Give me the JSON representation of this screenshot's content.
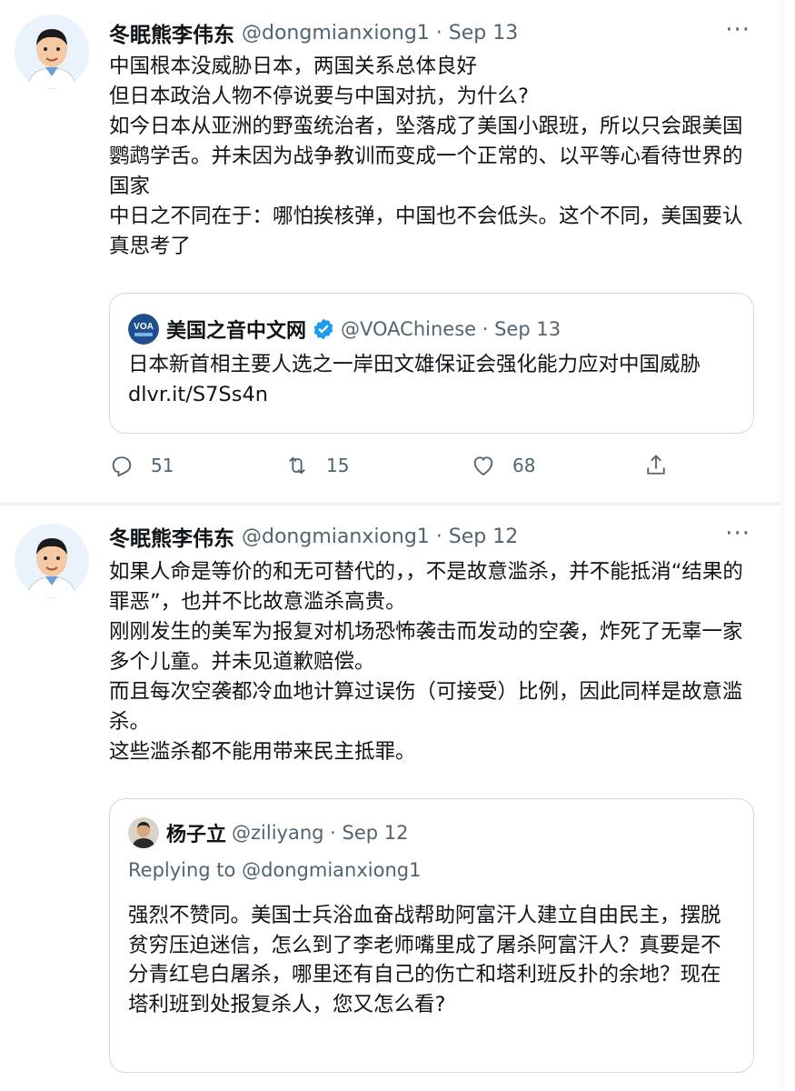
{
  "tweets": [
    {
      "author_name": "冬眠熊李伟东",
      "author_handle_date": "@dongmianxiong1 · Sep 13",
      "more_label": "···",
      "body": [
        "中国根本没威胁日本，两国关系总体良好",
        "但日本政治人物不停说要与中国对抗，为什么?",
        "如今日本从亚洲的野蛮统治者，坠落成了美国小跟班，所以只会跟美国鹦鹉学舌。并未因为战争教训而变成一个正常的、以平等心看待世界的国家",
        "中日之不同在于：哪怕挨核弹，中国也不会低头。这个不同，美国要认真思考了"
      ],
      "quote": {
        "name": "美国之音中文网",
        "handle_date": "@VOAChinese · Sep 13",
        "avatar_text": "VOA",
        "body": "日本新首相主要人选之一岸田文雄保证会强化能力应对中国威胁 dlvr.it/S7Ss4n"
      },
      "actions": {
        "reply_count": "51",
        "retweet_count": "15",
        "like_count": "68"
      }
    },
    {
      "author_name": "冬眠熊李伟东",
      "author_handle_date": "@dongmianxiong1 · Sep 12",
      "more_label": "···",
      "body": [
        "如果人命是等价的和无可替代的，，不是故意滥杀，并不能抵消“结果的罪恶”，也并不比故意滥杀高贵。",
        "刚刚发生的美军为报复对机场恐怖袭击而发动的空袭，炸死了无辜一家多个儿童。并未见道歉赔偿。",
        "而且每次空袭都冷血地计算过误伤（可接受）比例，因此同样是故意滥杀。",
        "这些滥杀都不能用带来民主抵罪。"
      ],
      "quote": {
        "name": "杨子立",
        "handle_date": "@ziliyang · Sep 12",
        "replying_to": "Replying to @dongmianxiong1",
        "body": "强烈不赞同。美国士兵浴血奋战帮助阿富汗人建立自由民主，摆脱贫穷压迫迷信，怎么到了李老师嘴里成了屠杀阿富汗人？真要是不分青红皂白屠杀，哪里还有自己的伤亡和塔利班反扑的余地？现在塔利班到处报复杀人，您又怎么看?"
      },
      "colors": {
        "text": "#0f1419",
        "secondary": "#536471",
        "border": "#cfd9de",
        "verified": "#1d9bf0"
      }
    }
  ]
}
